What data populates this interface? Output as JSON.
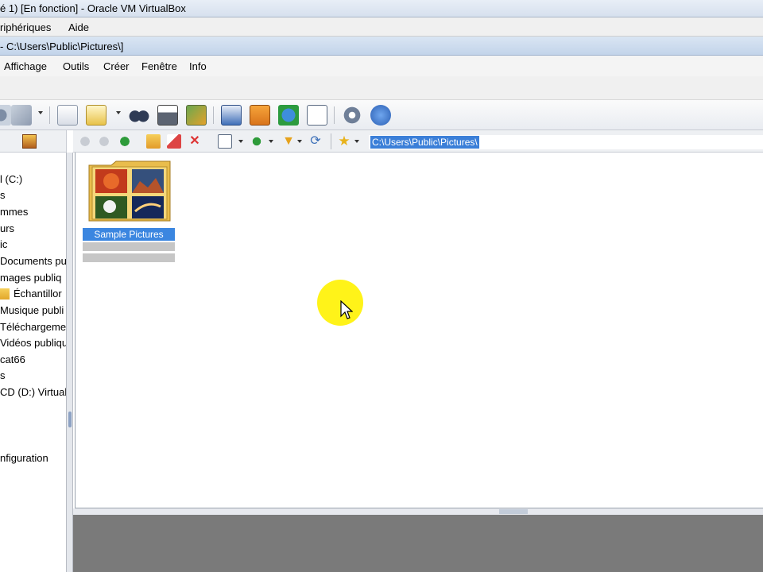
{
  "vbox": {
    "title": "é 1) [En fonction] - Oracle VM VirtualBox",
    "menu": [
      "riphériques",
      "Aide"
    ]
  },
  "app": {
    "title": "- C:\\Users\\Public\\Pictures\\]",
    "menu": [
      "Affichage",
      "Outils",
      "Créer",
      "Fenêtre",
      "Info"
    ]
  },
  "toolbar": {
    "icons": [
      "slideshow-icon",
      "open-icon",
      "copy-move-icon",
      "find-icon",
      "print-icon",
      "convert-icon",
      "scan-icon",
      "screenshot-icon",
      "web-icon",
      "properties-icon",
      "settings-icon",
      "info-icon"
    ]
  },
  "browser_toolbar": {
    "icons": [
      "back-icon",
      "forward-icon",
      "up-icon",
      "new-folder-icon",
      "rename-icon",
      "delete-icon",
      "view-mode-icon",
      "sort-icon",
      "filter-icon",
      "refresh-icon",
      "favorites-icon"
    ],
    "path": "C:\\Users\\Public\\Pictures\\"
  },
  "tree": {
    "items": [
      {
        "label": "l (C:)",
        "top": 0
      },
      {
        "label": "s",
        "top": 0
      },
      {
        "label": "mmes",
        "top": 0
      },
      {
        "label": "urs",
        "top": 0
      },
      {
        "label": "ic",
        "top": 0
      },
      {
        "label": "Documents pu",
        "top": 0
      },
      {
        "label": "mages publiq",
        "top": 0
      },
      {
        "label": "Échantillor",
        "top": 0
      },
      {
        "label": "Musique publi",
        "top": 0
      },
      {
        "label": "Téléchargeme",
        "top": 0
      },
      {
        "label": "Vidéos publiqu",
        "top": 0
      },
      {
        "label": "cat66",
        "top": 0
      },
      {
        "label": "s",
        "top": 0
      },
      {
        "label": "CD (D:) Virtual",
        "top": 0
      },
      {
        "label": "nfiguration",
        "top": 0
      }
    ]
  },
  "files": [
    {
      "name": "Sample Pictures",
      "selected": true
    }
  ],
  "colors": {
    "selection": "#3b86e0",
    "cursor_halo": "#fff200"
  }
}
